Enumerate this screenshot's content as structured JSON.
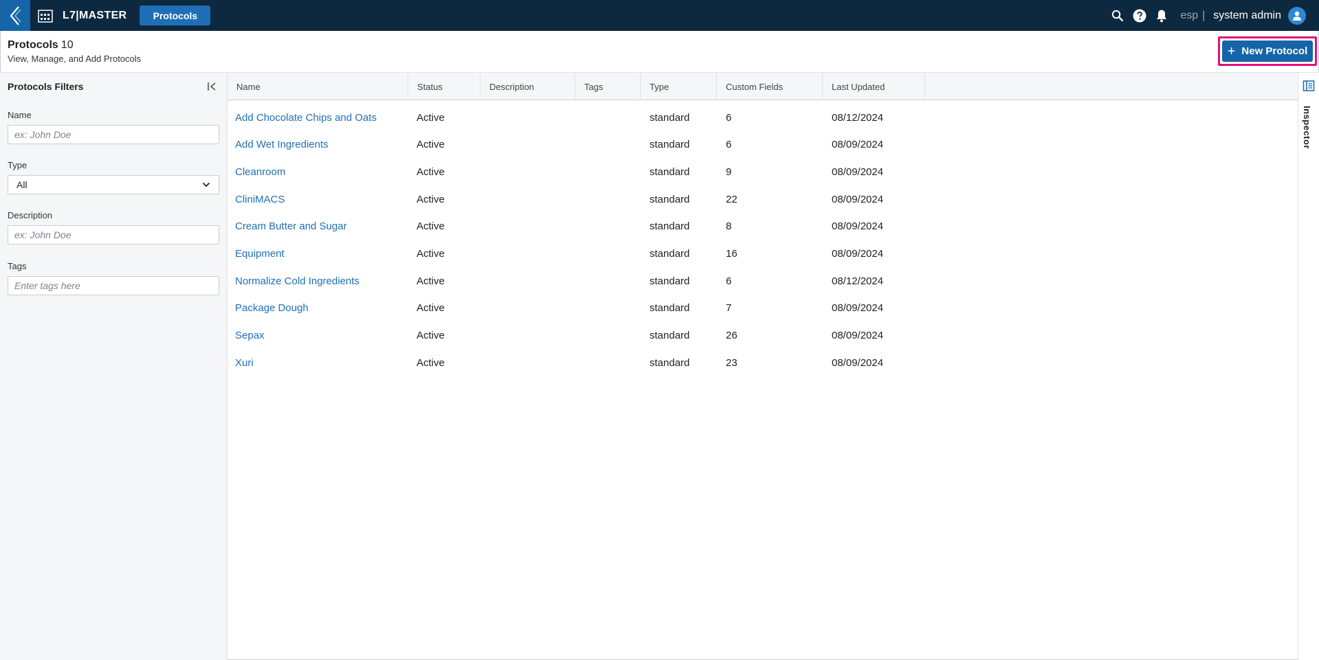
{
  "topbar": {
    "logo_text": "L7|MASTER",
    "nav_tab": "Protocols",
    "language": "esp",
    "language_sep": "|",
    "user_name": "system admin",
    "icons": [
      "back-chevron-icon",
      "logo-icon",
      "search-icon",
      "help-icon",
      "bell-icon",
      "user-avatar-icon"
    ]
  },
  "header": {
    "title": "Protocols",
    "count": "10",
    "subtitle": "View, Manage, and Add Protocols",
    "new_button_plus": "+",
    "new_button_label": "New Protocol"
  },
  "filters": {
    "title": "Protocols Filters",
    "name_label": "Name",
    "name_placeholder": "ex: John Doe",
    "type_label": "Type",
    "type_value": "All",
    "description_label": "Description",
    "description_placeholder": "ex: John Doe",
    "tags_label": "Tags",
    "tags_placeholder": "Enter tags here"
  },
  "table": {
    "columns": [
      "Name",
      "Status",
      "Description",
      "Tags",
      "Type",
      "Custom Fields",
      "Last Updated"
    ],
    "rows": [
      {
        "name": "Add Chocolate Chips and Oats",
        "status": "Active",
        "description": "",
        "tags": "",
        "type": "standard",
        "custom_fields": "6",
        "last_updated": "08/12/2024"
      },
      {
        "name": "Add Wet Ingredients",
        "status": "Active",
        "description": "",
        "tags": "",
        "type": "standard",
        "custom_fields": "6",
        "last_updated": "08/09/2024"
      },
      {
        "name": "Cleanroom",
        "status": "Active",
        "description": "",
        "tags": "",
        "type": "standard",
        "custom_fields": "9",
        "last_updated": "08/09/2024"
      },
      {
        "name": "CliniMACS",
        "status": "Active",
        "description": "",
        "tags": "",
        "type": "standard",
        "custom_fields": "22",
        "last_updated": "08/09/2024"
      },
      {
        "name": "Cream Butter and Sugar",
        "status": "Active",
        "description": "",
        "tags": "",
        "type": "standard",
        "custom_fields": "8",
        "last_updated": "08/09/2024"
      },
      {
        "name": "Equipment",
        "status": "Active",
        "description": "",
        "tags": "",
        "type": "standard",
        "custom_fields": "16",
        "last_updated": "08/09/2024"
      },
      {
        "name": "Normalize Cold Ingredients",
        "status": "Active",
        "description": "",
        "tags": "",
        "type": "standard",
        "custom_fields": "6",
        "last_updated": "08/12/2024"
      },
      {
        "name": "Package Dough",
        "status": "Active",
        "description": "",
        "tags": "",
        "type": "standard",
        "custom_fields": "7",
        "last_updated": "08/09/2024"
      },
      {
        "name": "Sepax",
        "status": "Active",
        "description": "",
        "tags": "",
        "type": "standard",
        "custom_fields": "26",
        "last_updated": "08/09/2024"
      },
      {
        "name": "Xuri",
        "status": "Active",
        "description": "",
        "tags": "",
        "type": "standard",
        "custom_fields": "23",
        "last_updated": "08/09/2024"
      }
    ]
  },
  "inspector": {
    "label": "Inspector"
  },
  "colors": {
    "topbar_bg": "#0d2940",
    "accent": "#1565a8",
    "link": "#1f6fb6",
    "highlight_border": "#e0107d"
  }
}
